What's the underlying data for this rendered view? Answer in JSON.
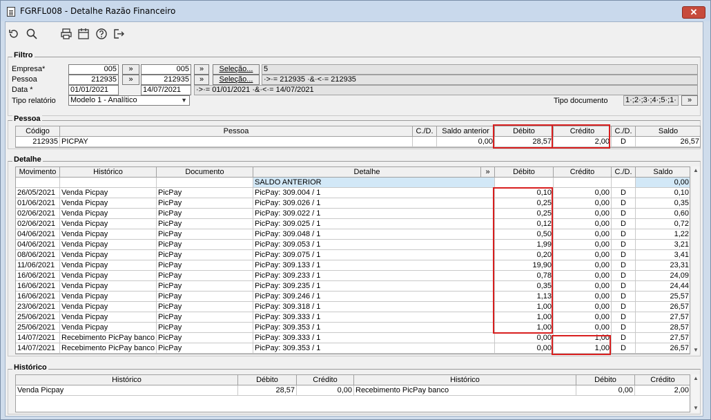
{
  "window": {
    "title": "FGRFL008 - Detalhe Razão Financeiro",
    "close_label": "✕"
  },
  "toolbar": {
    "icons": [
      "refresh-icon",
      "search-icon",
      "print-icon",
      "calendar-icon",
      "help-icon",
      "exit-icon"
    ]
  },
  "filtro": {
    "title": "Filtro",
    "empresa_label": "Empresa*",
    "empresa_from": "005",
    "empresa_to": "005",
    "empresa_result": "5",
    "pessoa_label": "Pessoa",
    "pessoa_from": "212935",
    "pessoa_to": "212935",
    "pessoa_result": "·>·= 212935 ·&·<·= 212935",
    "data_label": "Data *",
    "data_from": "01/01/2021",
    "data_to": "14/07/2021",
    "data_result": "·>·= 01/01/2021 ·&·<·= 14/07/2021",
    "tipo_relatorio_label": "Tipo relatório",
    "tipo_relatorio_value": "Modelo 1 - Analítico",
    "tipo_documento_label": "Tipo documento",
    "tipo_documento_value": "1·;2·;3·;4·;5·;1·",
    "range_btn": "»",
    "selecao_label": "Seleção..."
  },
  "pessoa": {
    "title": "Pessoa",
    "headers": [
      "Código",
      "Pessoa",
      "C./D.",
      "Saldo anterior",
      "Débito",
      "Crédito",
      "C./D.",
      "Saldo"
    ],
    "row": [
      "212935",
      "PICPAY",
      "",
      "0,00",
      "28,57",
      "2,00",
      "D",
      "26,57"
    ]
  },
  "detalhe": {
    "title": "Detalhe",
    "headers": [
      "Movimento",
      "Histórico",
      "Documento",
      "Detalhe",
      "»",
      "Débito",
      "Crédito",
      "C./D.",
      "Saldo"
    ],
    "rows": [
      [
        "",
        "",
        "",
        "SALDO ANTERIOR",
        "",
        "",
        "",
        "0,00"
      ],
      [
        "26/05/2021",
        "Venda Picpay",
        "PicPay",
        "PicPay: 309.004 / 1",
        "0,10",
        "0,00",
        "D",
        "0,10"
      ],
      [
        "01/06/2021",
        "Venda Picpay",
        "PicPay",
        "PicPay: 309.026 / 1",
        "0,25",
        "0,00",
        "D",
        "0,35"
      ],
      [
        "02/06/2021",
        "Venda Picpay",
        "PicPay",
        "PicPay: 309.022 / 1",
        "0,25",
        "0,00",
        "D",
        "0,60"
      ],
      [
        "02/06/2021",
        "Venda Picpay",
        "PicPay",
        "PicPay: 309.025 / 1",
        "0,12",
        "0,00",
        "D",
        "0,72"
      ],
      [
        "04/06/2021",
        "Venda Picpay",
        "PicPay",
        "PicPay: 309.048 / 1",
        "0,50",
        "0,00",
        "D",
        "1,22"
      ],
      [
        "04/06/2021",
        "Venda Picpay",
        "PicPay",
        "PicPay: 309.053 / 1",
        "1,99",
        "0,00",
        "D",
        "3,21"
      ],
      [
        "08/06/2021",
        "Venda Picpay",
        "PicPay",
        "PicPay: 309.075 / 1",
        "0,20",
        "0,00",
        "D",
        "3,41"
      ],
      [
        "11/06/2021",
        "Venda Picpay",
        "PicPay",
        "PicPay: 309.133 / 1",
        "19,90",
        "0,00",
        "D",
        "23,31"
      ],
      [
        "16/06/2021",
        "Venda Picpay",
        "PicPay",
        "PicPay: 309.233 / 1",
        "0,78",
        "0,00",
        "D",
        "24,09"
      ],
      [
        "16/06/2021",
        "Venda Picpay",
        "PicPay",
        "PicPay: 309.235 / 1",
        "0,35",
        "0,00",
        "D",
        "24,44"
      ],
      [
        "16/06/2021",
        "Venda Picpay",
        "PicPay",
        "PicPay: 309.246 / 1",
        "1,13",
        "0,00",
        "D",
        "25,57"
      ],
      [
        "23/06/2021",
        "Venda Picpay",
        "PicPay",
        "PicPay: 309.318 / 1",
        "1,00",
        "0,00",
        "D",
        "26,57"
      ],
      [
        "25/06/2021",
        "Venda Picpay",
        "PicPay",
        "PicPay: 309.333 / 1",
        "1,00",
        "0,00",
        "D",
        "27,57"
      ],
      [
        "25/06/2021",
        "Venda Picpay",
        "PicPay",
        "PicPay: 309.353 / 1",
        "1,00",
        "0,00",
        "D",
        "28,57"
      ],
      [
        "14/07/2021",
        "Recebimento PicPay banco",
        "PicPay",
        "PicPay: 309.333 / 1",
        "0,00",
        "1,00",
        "D",
        "27,57"
      ],
      [
        "14/07/2021",
        "Recebimento PicPay banco",
        "PicPay",
        "PicPay: 309.353 / 1",
        "0,00",
        "1,00",
        "D",
        "26,57"
      ]
    ]
  },
  "historico": {
    "title": "Histórico",
    "headers": [
      "Histórico",
      "Débito",
      "Crédito",
      "Histórico",
      "Débito",
      "Crédito"
    ],
    "row": [
      "Venda Picpay",
      "28,57",
      "0,00",
      "Recebimento PicPay banco",
      "0,00",
      "2,00"
    ]
  },
  "colors": {
    "highlight": "#d81e1e",
    "saldo_anterior_row": "#d2e8f7"
  }
}
